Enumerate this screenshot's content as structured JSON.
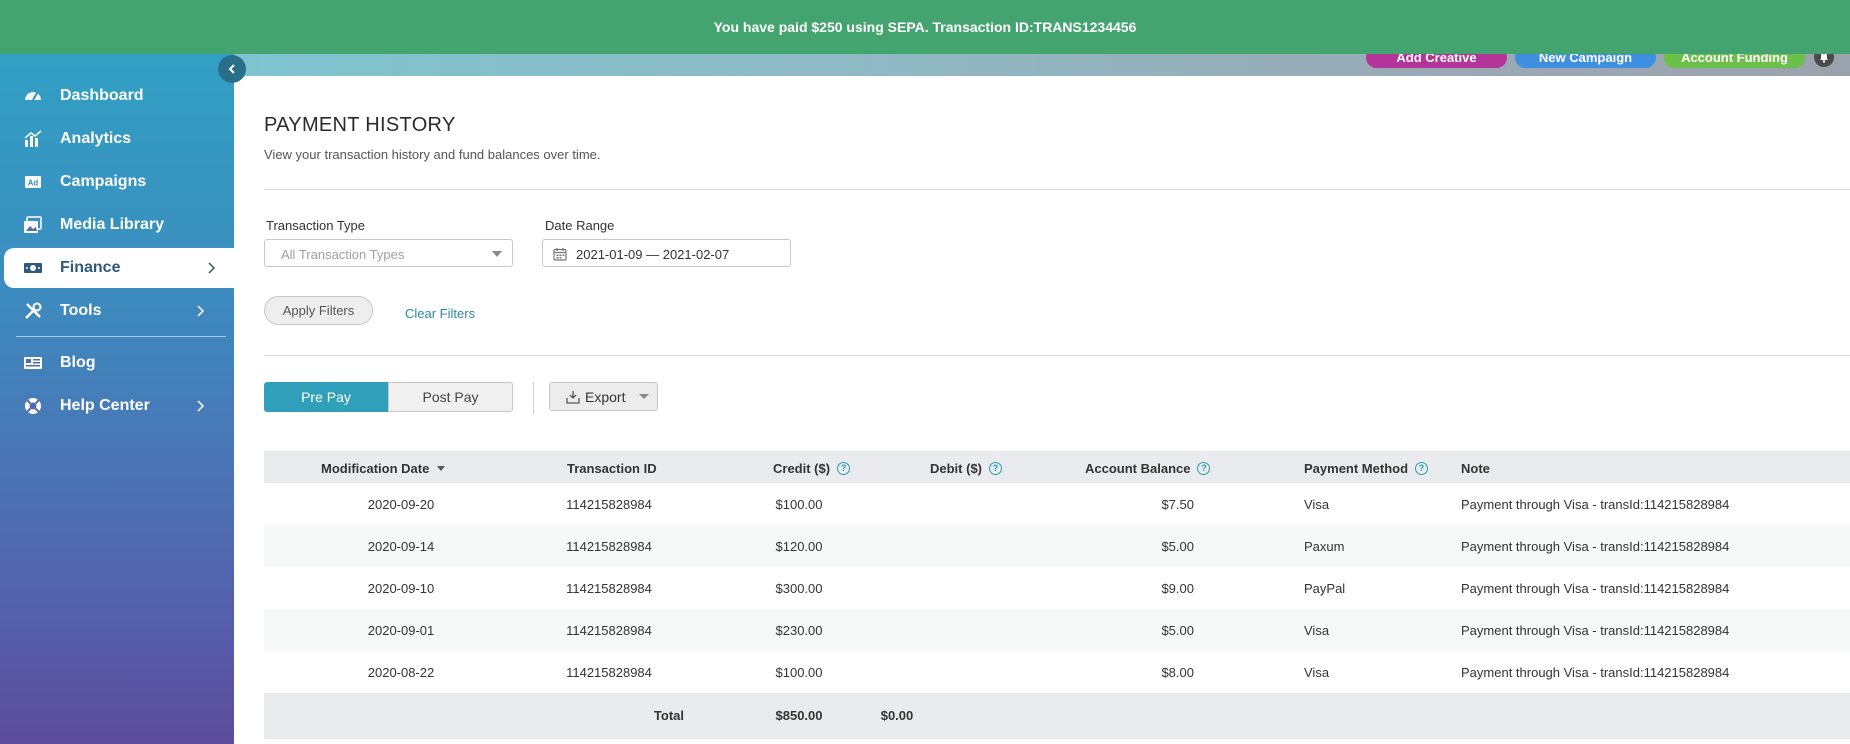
{
  "banner": {
    "message": "You have paid $250 using SEPA. Transaction ID:TRANS1234456"
  },
  "colors": {
    "banner": "#44a470",
    "accent": "#2f9fba",
    "add_creative": "#b4359a",
    "new_campaign": "#3f8fe0",
    "account_funding": "#6cc04a"
  },
  "header": {
    "add_creative": "Add Creative",
    "new_campaign": "New Campaign",
    "account_funding": "Account Funding",
    "notifications_icon": "bell-icon"
  },
  "sidebar": {
    "items": [
      {
        "label": "Dashboard",
        "icon": "speedometer-icon"
      },
      {
        "label": "Analytics",
        "icon": "bar-chart-icon"
      },
      {
        "label": "Campaigns",
        "icon": "ad-icon"
      },
      {
        "label": "Media Library",
        "icon": "images-icon"
      },
      {
        "label": "Finance",
        "icon": "money-icon",
        "active": true,
        "has_submenu": true
      },
      {
        "label": "Tools",
        "icon": "tools-icon",
        "has_submenu": true
      },
      {
        "label": "Blog",
        "icon": "newspaper-icon"
      },
      {
        "label": "Help Center",
        "icon": "lifebuoy-icon",
        "has_submenu": true
      }
    ]
  },
  "page": {
    "title": "PAYMENT HISTORY",
    "subtitle": "View your transaction history and fund balances over time."
  },
  "filters": {
    "transaction_type_label": "Transaction Type",
    "transaction_type_placeholder": "All Transaction Types",
    "date_range_label": "Date Range",
    "date_range_value": "2021-01-09 — 2021-02-07",
    "apply_label": "Apply Filters",
    "clear_label": "Clear Filters"
  },
  "toolbar": {
    "prepay_label": "Pre Pay",
    "postpay_label": "Post Pay",
    "export_label": "Export"
  },
  "table": {
    "columns": [
      "Modification Date",
      "Transaction ID",
      "Credit ($)",
      "Debit ($)",
      "Account Balance",
      "Payment Method",
      "Note"
    ],
    "rows": [
      {
        "date": "2020-09-20",
        "tid": "114215828984",
        "credit": "$100.00",
        "debit": "",
        "balance": "$7.50",
        "method": "Visa",
        "note": "Payment through Visa - transId:114215828984"
      },
      {
        "date": "2020-09-14",
        "tid": "114215828984",
        "credit": "$120.00",
        "debit": "",
        "balance": "$5.00",
        "method": "Paxum",
        "note": "Payment through Visa - transId:114215828984"
      },
      {
        "date": "2020-09-10",
        "tid": "114215828984",
        "credit": "$300.00",
        "debit": "",
        "balance": "$9.00",
        "method": "PayPal",
        "note": "Payment through Visa - transId:114215828984"
      },
      {
        "date": "2020-09-01",
        "tid": "114215828984",
        "credit": "$230.00",
        "debit": "",
        "balance": "$5.00",
        "method": "Visa",
        "note": "Payment through Visa - transId:114215828984"
      },
      {
        "date": "2020-08-22",
        "tid": "114215828984",
        "credit": "$100.00",
        "debit": "",
        "balance": "$8.00",
        "method": "Visa",
        "note": "Payment through Visa - transId:114215828984"
      }
    ],
    "total": {
      "label": "Total",
      "credit": "$850.00",
      "debit": "$0.00"
    }
  }
}
